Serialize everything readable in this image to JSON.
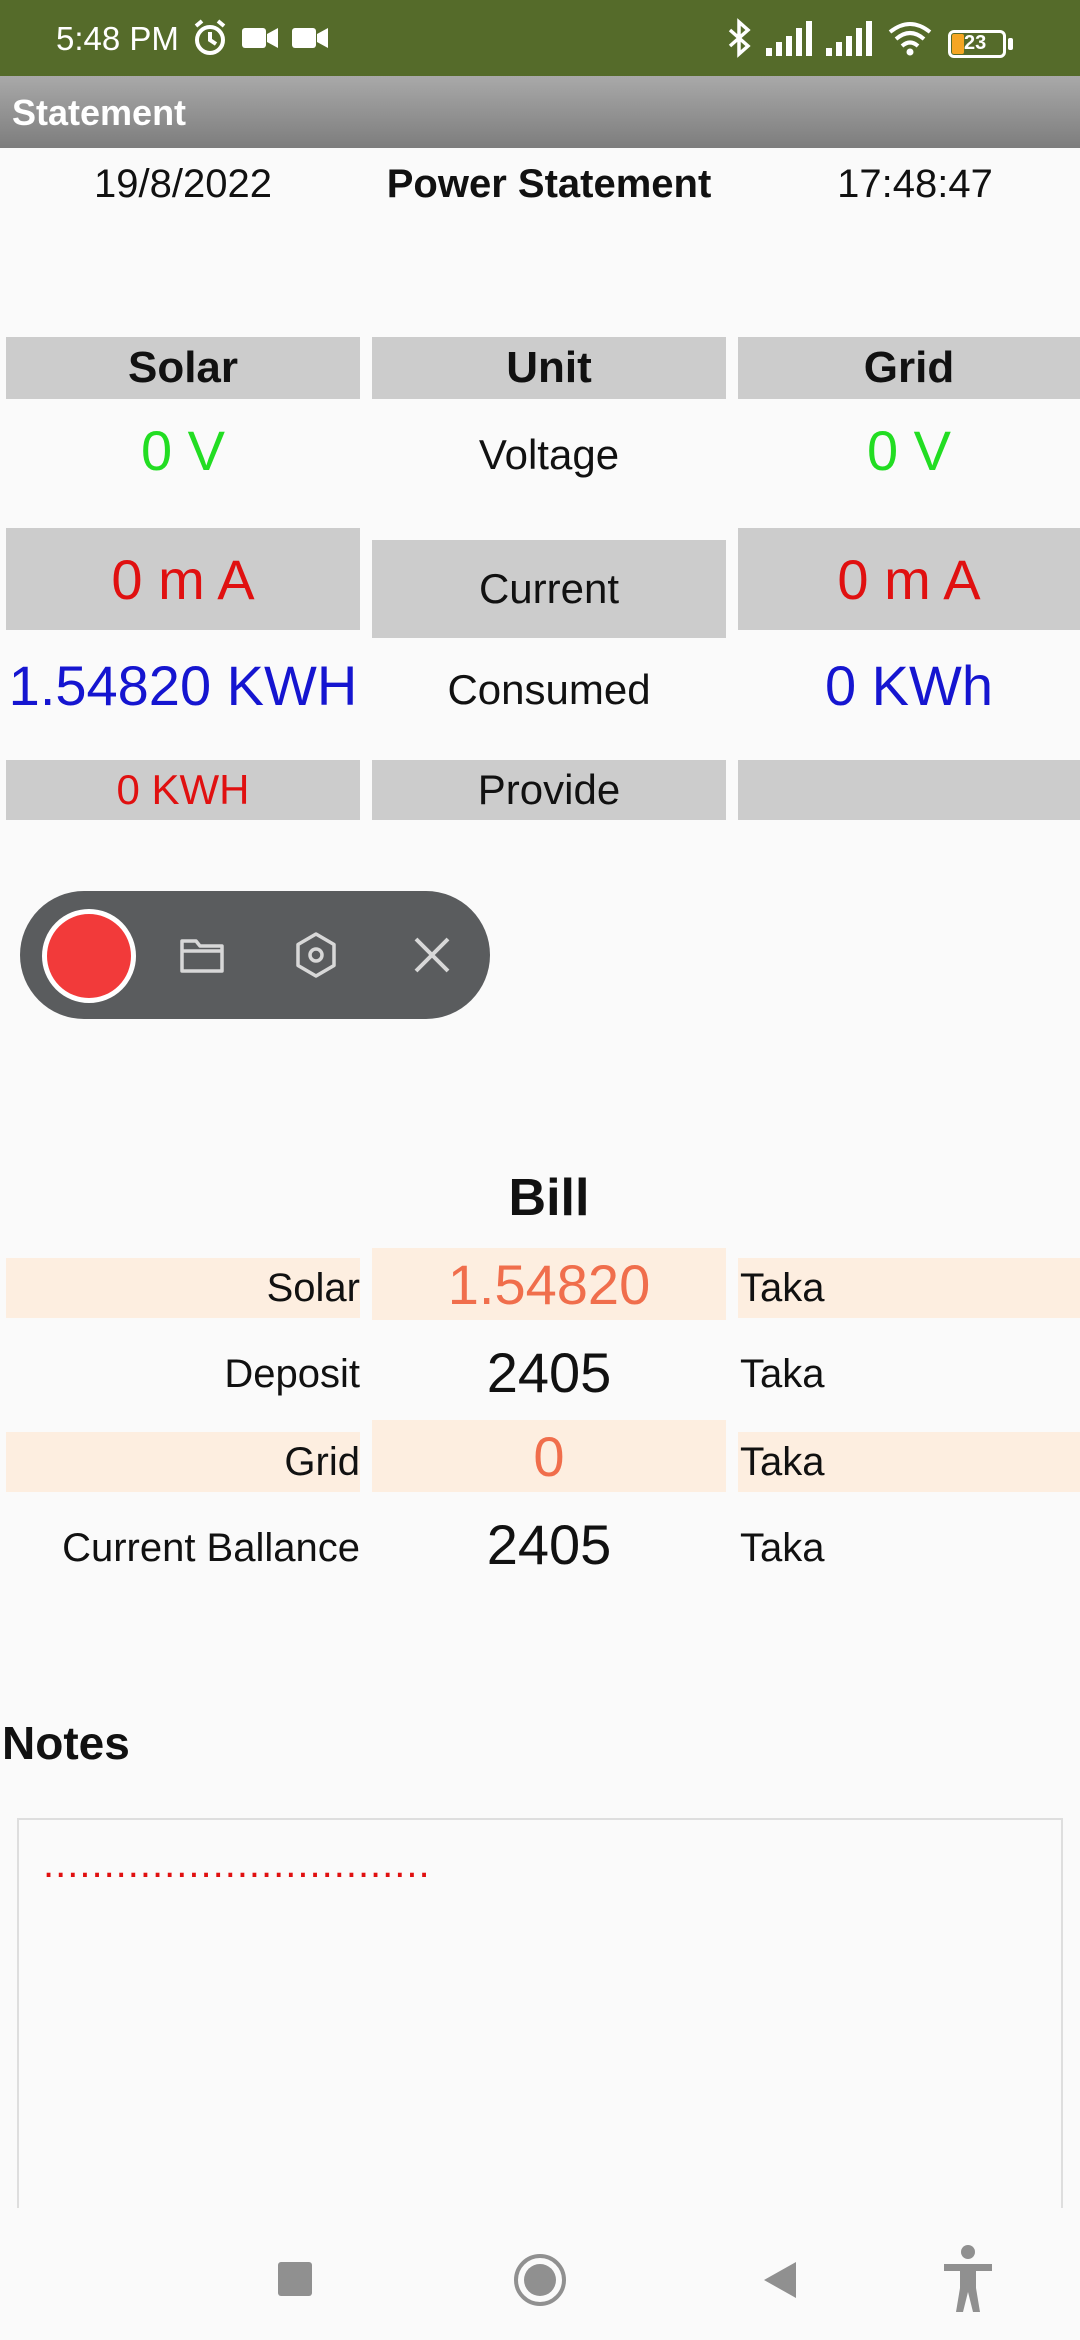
{
  "status_bar": {
    "time": "5:48 PM",
    "battery": "23"
  },
  "title_bar": {
    "title": "Statement"
  },
  "header": {
    "date": "19/8/2022",
    "title": "Power Statement",
    "clock": "17:48:47"
  },
  "table": {
    "col_solar": "Solar",
    "col_unit": "Unit",
    "col_grid": "Grid",
    "voltage": {
      "label": "Voltage",
      "solar": "0  V",
      "grid": "0  V"
    },
    "current": {
      "label": "Current",
      "solar": "0 m A",
      "grid": "0 m A"
    },
    "consumed": {
      "label": "Consumed",
      "solar": "1.54820  KWH",
      "grid": "0  KWh"
    },
    "provide": {
      "label": "Provide",
      "solar": "0  KWH",
      "grid": ""
    }
  },
  "bill": {
    "title": "Bill",
    "rows": [
      {
        "label": "Solar",
        "value": "1.54820",
        "unit": "Taka"
      },
      {
        "label": "Deposit",
        "value": "2405",
        "unit": "Taka"
      },
      {
        "label": "Grid",
        "value": "0",
        "unit": "Taka"
      },
      {
        "label": "Current Ballance",
        "value": "2405",
        "unit": "Taka"
      }
    ]
  },
  "notes": {
    "title": "Notes",
    "content": "................................"
  },
  "colors": {
    "status_bar": "#556b2a",
    "green": "#22dd22",
    "red": "#e01010",
    "blue": "#1515d0",
    "orange": "#f06e4c",
    "highlight": "#fdeee0"
  },
  "icons": [
    "clock-alarm-icon",
    "video-icon",
    "bluetooth-icon",
    "signal-icon",
    "wifi-icon",
    "battery-icon",
    "record-icon",
    "folder-icon",
    "settings-icon",
    "close-icon",
    "nav-square-icon",
    "nav-home-icon",
    "nav-back-icon",
    "accessibility-icon"
  ]
}
